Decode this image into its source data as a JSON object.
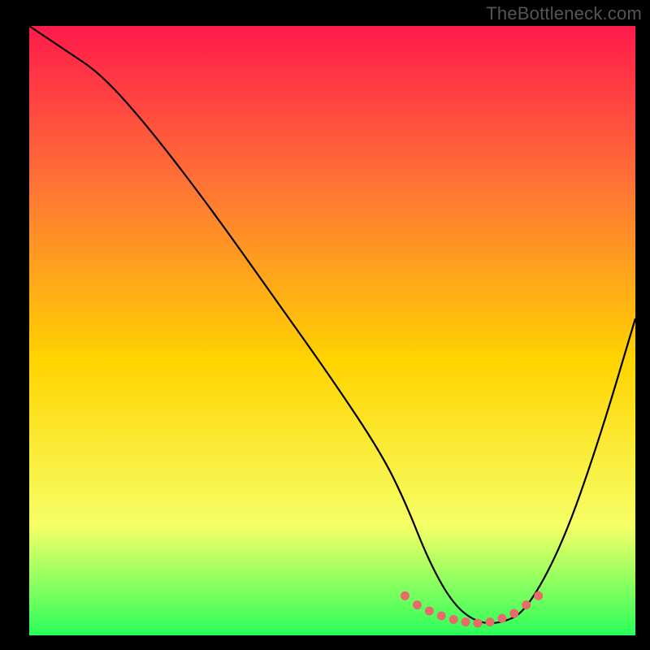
{
  "watermark": "TheBottleneck.com",
  "chart_data": {
    "type": "line",
    "title": "",
    "xlabel": "",
    "ylabel": "",
    "xlim": [
      0,
      100
    ],
    "ylim": [
      0,
      100
    ],
    "grid": false,
    "background_gradient": {
      "top": "#ff1a4b",
      "mid_upper": "#ff7a33",
      "mid": "#ffd400",
      "mid_lower": "#f6ff66",
      "bottom": "#2aff5a"
    },
    "series": [
      {
        "name": "bottleneck-curve",
        "color": "#000000",
        "x": [
          0,
          6,
          12,
          20,
          30,
          40,
          50,
          58,
          62,
          66,
          70,
          74,
          78,
          82,
          88,
          94,
          100
        ],
        "y": [
          100,
          96,
          92,
          83,
          70,
          56,
          42,
          30,
          22,
          12,
          5,
          2,
          2,
          4,
          15,
          32,
          52
        ]
      }
    ],
    "highlight_band": {
      "name": "optimal-zone-markers",
      "color": "#e86a6a",
      "x": [
        62,
        64,
        66,
        68,
        70,
        72,
        74,
        76,
        78,
        80,
        82,
        84
      ],
      "y": [
        6.5,
        5.0,
        4.0,
        3.2,
        2.6,
        2.2,
        2.0,
        2.2,
        2.8,
        3.6,
        5.0,
        6.5
      ]
    }
  }
}
